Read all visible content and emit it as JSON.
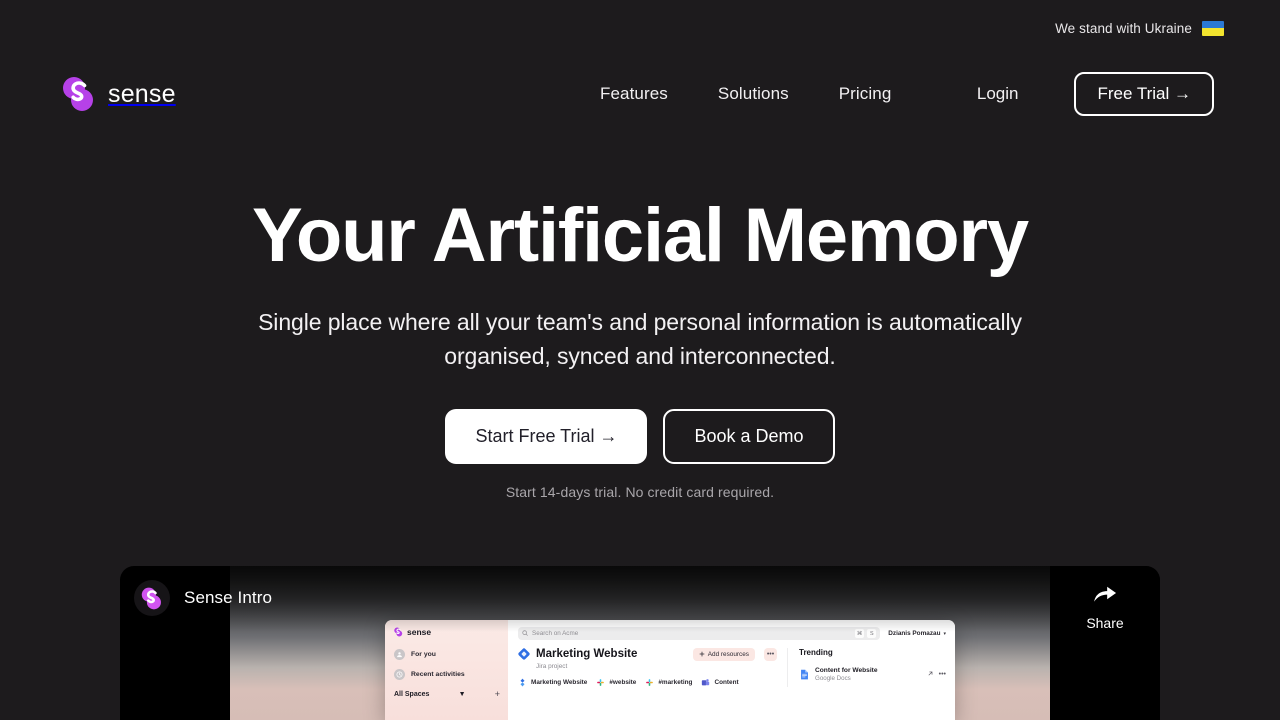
{
  "announcement": {
    "text": "We stand with Ukraine",
    "flag_icon": "ukraine-flag-icon",
    "flag_colors": {
      "top": "#2a79d4",
      "bottom": "#f2e42e"
    }
  },
  "header": {
    "brand": {
      "name": "sense",
      "logo_icon": "sense-logo-icon",
      "logo_color": "#b641e8"
    },
    "nav": [
      {
        "label": "Features",
        "name": "nav-features"
      },
      {
        "label": "Solutions",
        "name": "nav-solutions"
      },
      {
        "label": "Pricing",
        "name": "nav-pricing"
      }
    ],
    "login_label": "Login",
    "trial_label": "Free Trial →"
  },
  "hero": {
    "title": "Your Artificial Memory",
    "subtitle": "Single place where all your team's and personal information is automatically organised, synced and interconnected.",
    "primary_cta": "Start Free Trial →",
    "secondary_cta": "Book a Demo",
    "note": "Start 14-days trial. No credit card required."
  },
  "video": {
    "title": "Sense Intro",
    "channel_avatar_icon": "sense-logo-icon",
    "share_label": "Share",
    "share_icon": "share-arrow-icon"
  },
  "app_preview": {
    "brand": "sense",
    "sidebar": {
      "items": [
        {
          "label": "For you",
          "icon": "person-circle-icon"
        },
        {
          "label": "Recent activities",
          "icon": "clock-circle-icon"
        }
      ],
      "spaces_label": "All Spaces",
      "spaces_caret": "▼",
      "add_space_icon": "plus-icon",
      "add_space_label": "+"
    },
    "topbar": {
      "search_placeholder": "Search on Acme",
      "search_icon": "search-icon",
      "shortcut_keys": [
        "⌘",
        "S"
      ],
      "user_name": "Dzianis Pomazau",
      "user_caret": "▾"
    },
    "document": {
      "icon": "jira-diamond-icon",
      "title": "Marketing Website",
      "subtitle": "Jira project",
      "add_resources_label": "Add resources",
      "add_resources_icon": "plus-icon",
      "more_label": "•••",
      "tags": [
        {
          "label": "Marketing Website",
          "icon": "jira-icon"
        },
        {
          "label": "#website",
          "icon": "slack-icon"
        },
        {
          "label": "#marketing",
          "icon": "slack-icon"
        },
        {
          "label": "Content",
          "icon": "teams-icon"
        }
      ]
    },
    "trending": {
      "title": "Trending",
      "items": [
        {
          "name": "Content for Website",
          "source": "Google Docs",
          "icon": "google-docs-icon",
          "open_icon": "arrow-up-right-icon",
          "more_label": "•••"
        }
      ]
    }
  }
}
